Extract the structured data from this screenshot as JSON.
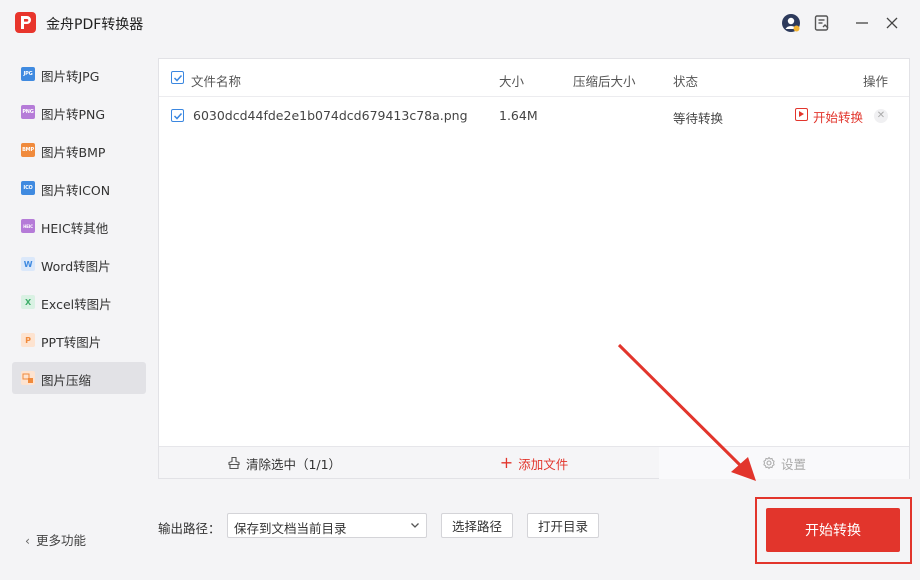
{
  "app": {
    "title": "金舟PDF转换器",
    "accent": "#e2352c"
  },
  "titlebar": {
    "icons": [
      "avatar-icon",
      "feedback-icon",
      "minimize-icon",
      "close-icon"
    ]
  },
  "sidebar": {
    "items": [
      {
        "label": "图片转JPG",
        "icon": "JPG",
        "color": "#3f8ae0"
      },
      {
        "label": "图片转PNG",
        "icon": "PNG",
        "color": "#b57bd8"
      },
      {
        "label": "图片转BMP",
        "icon": "BMP",
        "color": "#f08a3c"
      },
      {
        "label": "图片转ICON",
        "icon": "ICO",
        "color": "#3f8ae0"
      },
      {
        "label": "HEIC转其他",
        "icon": "HEIC",
        "color": "#b57bd8"
      },
      {
        "label": "Word转图片",
        "icon": "W",
        "color": "#3f8ae0"
      },
      {
        "label": "Excel转图片",
        "icon": "X",
        "color": "#3fae6a"
      },
      {
        "label": "PPT转图片",
        "icon": "P",
        "color": "#f08a3c"
      },
      {
        "label": "图片压缩",
        "icon": "compress",
        "color": "#f08a3c",
        "active": true
      }
    ],
    "more": "更多功能"
  },
  "table": {
    "headers": {
      "name": "文件名称",
      "size": "大小",
      "compressed": "压缩后大小",
      "status": "状态",
      "action": "操作"
    },
    "rows": [
      {
        "name": "6030dcd44fde2e1b074dcd679413c78a.png",
        "size": "1.64M",
        "compressed": "",
        "status": "等待转换",
        "action": "开始转换",
        "checked": true
      }
    ]
  },
  "footer": {
    "clear": "清除选中（1/1）",
    "add": "添加文件",
    "settings": "设置"
  },
  "output": {
    "label": "输出路径：",
    "select_value": "保存到文档当前目录",
    "choose_path": "选择路径",
    "open_dir": "打开目录"
  },
  "start_button": "开始转换"
}
